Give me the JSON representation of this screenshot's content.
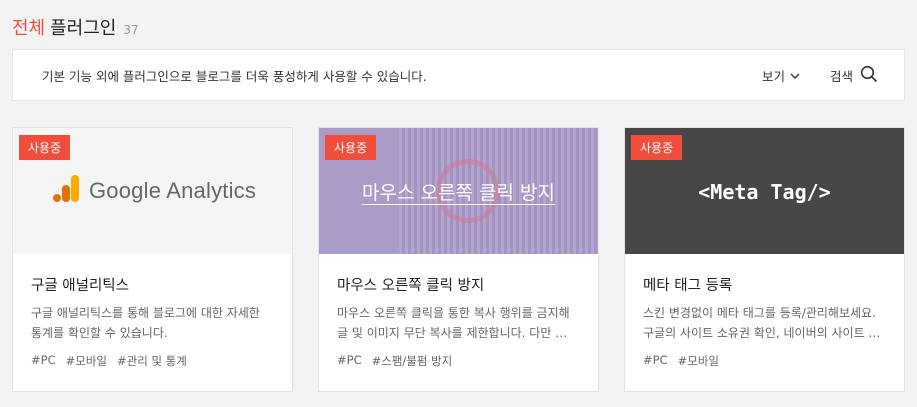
{
  "header": {
    "title_accent": "전체",
    "title_main": "플러그인",
    "count": "37"
  },
  "info_bar": {
    "description": "기본 기능 외에 플러그인으로 블로그를 더욱 풍성하게 사용할 수 있습니다.",
    "view_label": "보기",
    "search_label": "검색"
  },
  "cards": [
    {
      "badge": "사용중",
      "thumb_text": "Google Analytics",
      "title": "구글 애널리틱스",
      "desc": "구글 애널리틱스를 통해 블로그에 대한 자세한 통계를 확인할 수 있습니다.",
      "tags": [
        "#PC",
        "#모바일",
        "#관리 및 통계"
      ]
    },
    {
      "badge": "사용중",
      "thumb_text": "마우스 오른쪽 클릭 방지",
      "title": "마우스 오른쪽 클릭 방지",
      "desc": "마우스 오른쪽 클릭을 통한 복사 행위를 금지해 글 및 이미지 무단 복사를 제한합니다. 다만 …",
      "tags": [
        "#PC",
        "#스팸/불펌 방지"
      ]
    },
    {
      "badge": "사용중",
      "thumb_text": "<Meta Tag/>",
      "title": "메타 태그 등록",
      "desc": "스킨 변경없이 메타 태그를 등록/관리해보세요. 구글의 사이트 소유권 확인, 네이버의 사이트 …",
      "tags": [
        "#PC",
        "#모바일"
      ]
    }
  ],
  "colors": {
    "accent": "#f04e3b",
    "google_analytics_orange": "#f9ab00",
    "google_analytics_dark_orange": "#e37400",
    "right_click_purple": "#ab9bc8",
    "meta_tag_dark": "#474747"
  },
  "icons": {
    "view_chevron": "chevron-down-icon",
    "search": "search-icon",
    "google_analytics_logo": "google-analytics-logo-icon"
  }
}
